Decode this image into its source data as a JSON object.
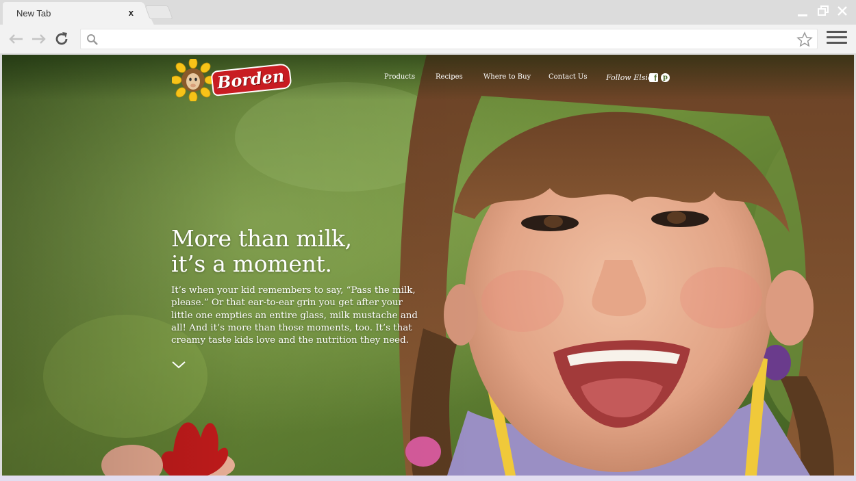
{
  "browser": {
    "tab_title": "New Tab",
    "tab_close": "x",
    "address_value": "",
    "icons": {
      "back": "back-arrow-icon",
      "forward": "forward-arrow-icon",
      "reload": "reload-icon",
      "search": "search-icon",
      "bookmark": "star-icon",
      "menu": "hamburger-menu-icon",
      "minimize": "minimize-icon",
      "maximize": "restore-icon",
      "close": "close-icon"
    }
  },
  "site": {
    "logo_text": "Borden",
    "nav": {
      "products": "Products",
      "recipes": "Recipes",
      "where_to_buy": "Where to Buy",
      "contact_us": "Contact Us",
      "follow": "Follow Elsie"
    },
    "social": {
      "facebook": "f",
      "pinterest": "p"
    },
    "hero": {
      "title_line1": "More than milk,",
      "title_line2": "it’s a moment.",
      "body": "It’s when your kid remembers to say, “Pass the milk, please.” Or that ear-to-ear grin you get after your little one empties an entire glass, milk mustache and all! And it’s more than those moments, too. It’s that creamy taste kids love and the nutrition they need."
    }
  },
  "colors": {
    "chrome": "#dcdcdc",
    "tab": "#f2f2f2",
    "brand_red": "#c81c22",
    "brand_yellow": "#f7c318",
    "foliage": "#5a7c34"
  }
}
